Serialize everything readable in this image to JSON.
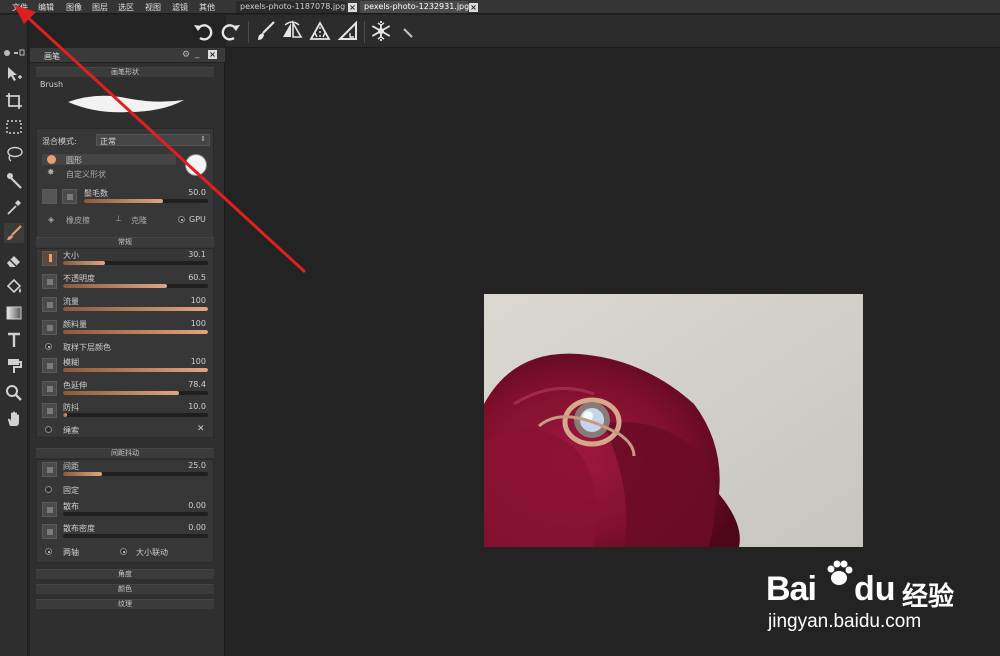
{
  "menubar": {
    "items": [
      "文件",
      "编辑",
      "图像",
      "图层",
      "选区",
      "视图",
      "滤镜",
      "其他"
    ],
    "tabs": [
      {
        "label": "pexels-photo-1187078.jpg",
        "active": false
      },
      {
        "label": "pexels-photo-1232931.jpg",
        "active": true
      }
    ]
  },
  "toolbar": {
    "icons": [
      "undo-icon",
      "redo-icon",
      "brush-icon",
      "flip-icon",
      "symmetry-icon",
      "ruler-icon",
      "snowflake-icon",
      "pen-icon"
    ]
  },
  "toolbox": {
    "tools": [
      "move-icon",
      "crop-icon",
      "marquee-icon",
      "lasso-icon",
      "magic-wand-icon",
      "eyedropper-icon",
      "brush-icon",
      "eraser-icon",
      "fill-icon",
      "gradient-icon",
      "text-icon",
      "stamp-icon",
      "zoom-icon",
      "hand-icon"
    ],
    "active": "brush-icon"
  },
  "panel": {
    "title": "画笔",
    "brush_shape": {
      "header": "画笔形状",
      "brush_label": "Brush"
    },
    "blend": {
      "label": "混合模式:",
      "value": "正常"
    },
    "shape_options": {
      "option1": "圆形",
      "option2": "自定义形状"
    },
    "bristle": {
      "label": "鬃毛数",
      "value": "50.0",
      "fraction": 0.64
    },
    "modes": {
      "eraser": "橡皮擦",
      "clone": "克隆",
      "gpu": "GPU"
    },
    "general": {
      "header": "常规",
      "sliders": [
        {
          "label": "大小",
          "value": "30.1",
          "fraction": 0.29
        },
        {
          "label": "不透明度",
          "value": "60.5",
          "fraction": 0.72
        },
        {
          "label": "流量",
          "value": "100",
          "fraction": 1.0
        },
        {
          "label": "颜料量",
          "value": "100",
          "fraction": 1.0
        }
      ],
      "sample_label": "取样下层颜色",
      "sliders2": [
        {
          "label": "模糊",
          "value": "100",
          "fraction": 1.0
        },
        {
          "label": "色延伸",
          "value": "78.4",
          "fraction": 0.8
        },
        {
          "label": "防抖",
          "value": "10.0",
          "fraction": 0.03
        }
      ],
      "lasso_label": "绳索"
    },
    "spacing": {
      "header": "间距抖动",
      "spacing_label": "间距",
      "spacing_value": "25.0",
      "spacing_fraction": 0.27,
      "fixed_label": "固定",
      "scatter_label": "散布",
      "scatter_value": "0.00",
      "scatter_fraction": 0.0,
      "density_label": "散布密度",
      "density_value": "0.00",
      "density_fraction": 0.0,
      "axis_label": "两轴",
      "link_label": "大小联动"
    },
    "collapsed": [
      "角度",
      "颜色",
      "纹理"
    ]
  },
  "watermark": {
    "text1": "Bai",
    "text2": "du",
    "text3": "经验",
    "url": "jingyan.baidu.com"
  },
  "colors": {
    "accent": "#e0a680",
    "annotation_arrow": "#e02020"
  }
}
